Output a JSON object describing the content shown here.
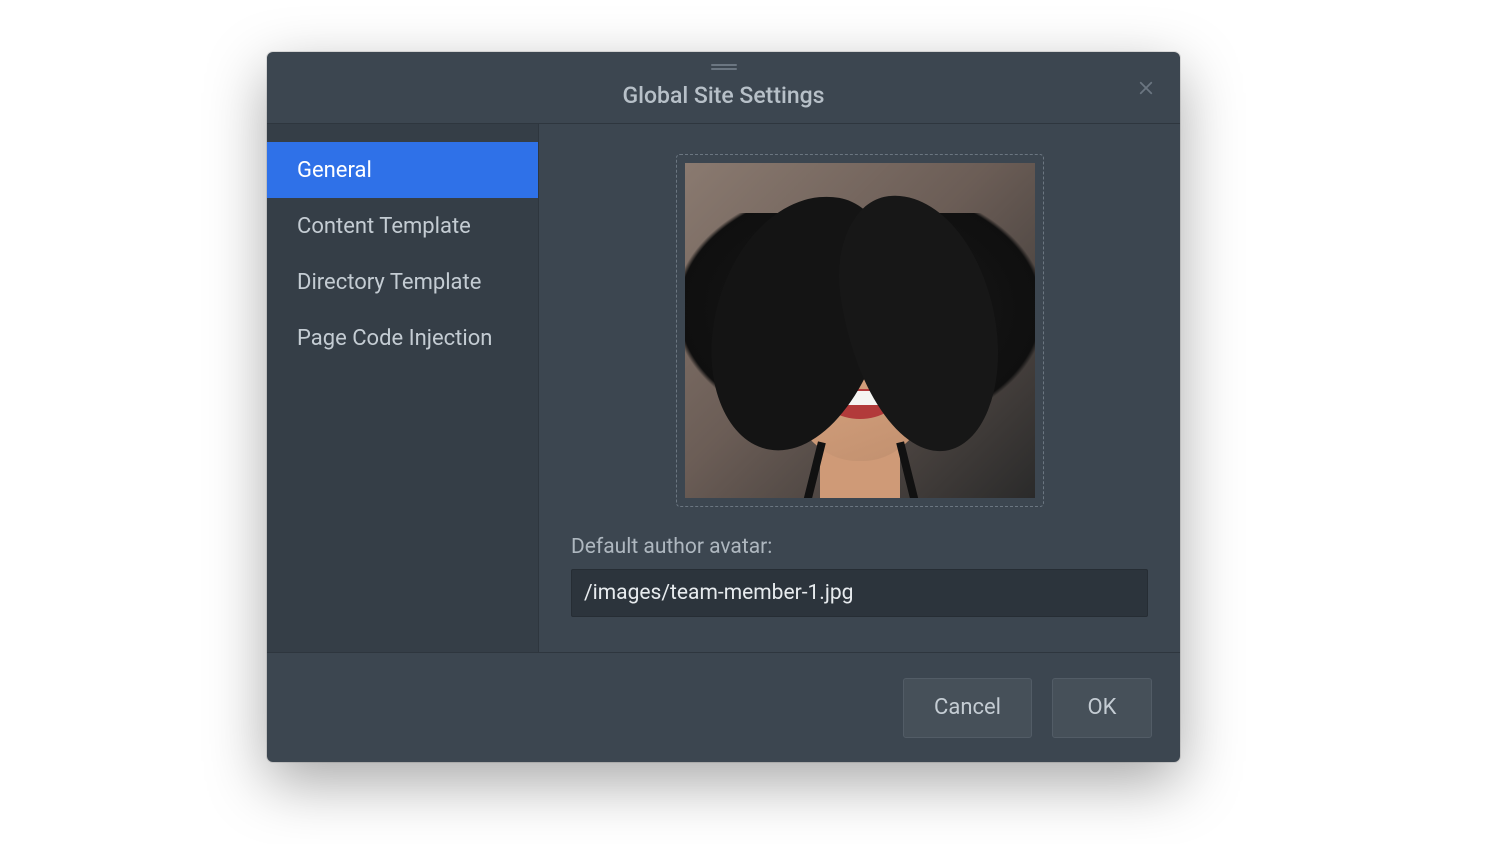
{
  "dialog": {
    "title": "Global Site Settings"
  },
  "sidebar": {
    "items": [
      {
        "label": "General",
        "active": true
      },
      {
        "label": "Content Template",
        "active": false
      },
      {
        "label": "Directory Template",
        "active": false
      },
      {
        "label": "Page Code Injection",
        "active": false
      }
    ]
  },
  "main": {
    "avatar_label": "Default author avatar:",
    "avatar_path": "/images/team-member-1.jpg"
  },
  "footer": {
    "cancel": "Cancel",
    "ok": "OK"
  },
  "icons": {
    "close": "close-icon",
    "drag": "drag-handle-icon"
  }
}
